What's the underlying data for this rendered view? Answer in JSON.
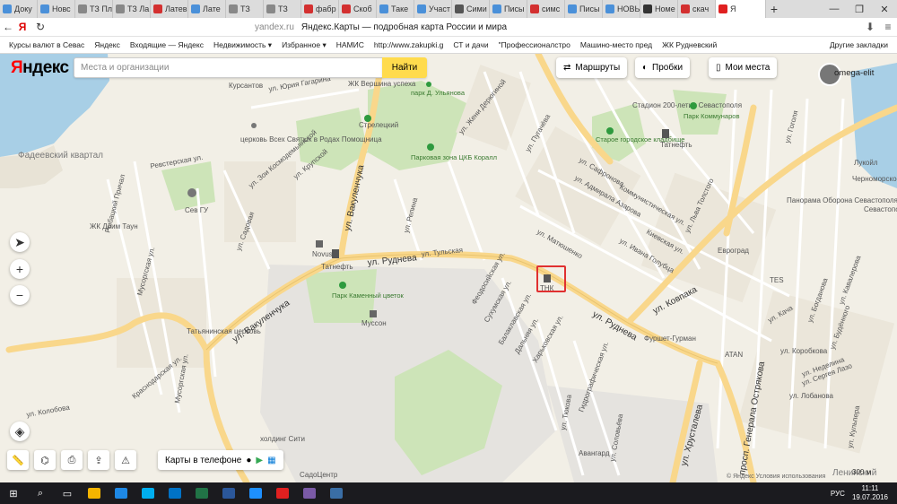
{
  "browser": {
    "tabs": [
      {
        "label": "Доку",
        "color": "#4a90d9"
      },
      {
        "label": "Новс",
        "color": "#4a90d9"
      },
      {
        "label": "ТЗ Пл",
        "color": "#888888"
      },
      {
        "label": "ТЗ Ла",
        "color": "#888888"
      },
      {
        "label": "Латев",
        "color": "#d33030"
      },
      {
        "label": "Лате",
        "color": "#4a90d9"
      },
      {
        "label": "ТЗ",
        "color": "#888888"
      },
      {
        "label": "ТЗ",
        "color": "#888888"
      },
      {
        "label": "фабр",
        "color": "#d33030"
      },
      {
        "label": "Скоб",
        "color": "#d33030"
      },
      {
        "label": "Таке",
        "color": "#4a90d9"
      },
      {
        "label": "Участ",
        "color": "#4a90d9"
      },
      {
        "label": "Сими",
        "color": "#555555"
      },
      {
        "label": "Писы",
        "color": "#4a90d9"
      },
      {
        "label": "симс",
        "color": "#d33030"
      },
      {
        "label": "Писы",
        "color": "#4a90d9"
      },
      {
        "label": "НОВЫ",
        "color": "#4a90d9"
      },
      {
        "label": "Номе",
        "color": "#333333"
      },
      {
        "label": "скач",
        "color": "#d33030"
      },
      {
        "label": "Я",
        "color": "#e02020"
      }
    ],
    "address": {
      "logo_letter": "Я",
      "domain": "yandex.ru",
      "title": "Яндекс.Карты — подробная карта России и мира"
    },
    "bookmarks": [
      "Курсы валют в Севас",
      "Яндекс",
      "Входящие — Яндекс",
      "Недвижимость ▾",
      "Избранное ▾",
      "НАМИС",
      "http://www.zakupki.g",
      "СТ и дачи",
      "\"Профессионалстро",
      "Машино-место пред",
      "ЖК Рудневский"
    ],
    "bookmarks_other": "Другие закладки"
  },
  "map_ui": {
    "logo_ya": "Я",
    "logo_rest": "ндекс",
    "search_placeholder": "Места и организации",
    "search_button": "Найти",
    "routes_button": "Маршруты",
    "traffic_button": "Пробки",
    "my_places_button": "Мои места",
    "username": "omega-elit",
    "phone_label": "Карты в телефоне",
    "scale_label": "300 м",
    "copyright": "© Яндекс Условия использования"
  },
  "map_labels": {
    "districts": [
      "Фадеевский квартал",
      "Ленинский"
    ],
    "roads": [
      "ул. Руднева",
      "ул. Вакуленчука",
      "ул. Ковпака",
      "ул. Руднева",
      "ул. Хрусталева",
      "просп. Генерала Острякова",
      "ул. Вакуленчука"
    ],
    "streets": [
      "ул. Гагарина",
      "ул. Юрия Гагарина",
      "ул. Зои Космодемьянской",
      "ул. Крупской",
      "ул. Глухова",
      "ул. Садовая",
      "ул. Тульская",
      "ул. Репина",
      "ул. Жени Дерюгиной",
      "ул. Пугачёва",
      "ул. Матюшенко",
      "Киевская ул.",
      "ул. Льва Толстого",
      "ул. Гоголя",
      "ул. Адмирала Азарова",
      "Коммунистическая ул.",
      "ул. Сафронова",
      "ул. Ивана Голубца",
      "Рыбацкий Причал",
      "Ревстерская ул.",
      "Мусоргская ул.",
      "Кожанова ул.",
      "ул. Колобова",
      "Краснодарская ул.",
      "Гидрографическая ул.",
      "ул. Тюкова",
      "ул. Соловьёва",
      "ул. Гидрографическая",
      "Харьковская ул.",
      "Дальняя ул.",
      "Балаклавская ул.",
      "Сухумская ул.",
      "Феодосийская ул.",
      "ул. Лобанова",
      "ул. Коробкова",
      "ул. Кульпера",
      "ул. Богданова",
      "ул. Будённого",
      "ул. Кукловского",
      "ул. Кача",
      "ул. Частника",
      "ул. Неделина",
      "ул. Сергея Лазо",
      "ул. Кавалерова"
    ],
    "pois": [
      "Стрелецкий",
      "церковь Всех Святых в Родах Помощница",
      "Сев ГУ",
      "Татнефть",
      "Novus",
      "Муссон",
      "Парк Каменный цветок",
      "Парковая зона ЦКБ Коралл",
      "парк Д. Ульянова",
      "ЖК Вершина успеха",
      "Стадион 200-летия Севастополя",
      "Парк Коммунаров",
      "Старое городское кладбище",
      "ТНК",
      "Евроград",
      "Фуршет-Гурман",
      "ATAN",
      "TES",
      "Татнефть",
      "Панорама Оборона Севастополя",
      "Севастопольская",
      "Авангард",
      "холдинг Сити",
      "СадоЦентр",
      "ЖК Дрим Таун",
      "Татьянинская церковь",
      "Лукойл",
      "Черноморское",
      "Адмиралтейский",
      "Курсантов",
      "Мебель",
      "Свет",
      "Рыбацкая ул."
    ]
  },
  "taskbar": {
    "time": "11:11",
    "date": "19.07.2016",
    "lang": "РУС",
    "apps": [
      {
        "color": "#f4b400"
      },
      {
        "color": "#1e88e5"
      },
      {
        "color": "#00aff0"
      },
      {
        "color": "#0072c6"
      },
      {
        "color": "#217346"
      },
      {
        "color": "#2b579a"
      },
      {
        "color": "#1e90ff"
      },
      {
        "color": "#e02020"
      },
      {
        "color": "#7a5aa6"
      },
      {
        "color": "#3a6ea5"
      }
    ]
  },
  "colors": {
    "map_bg": "#f2efe6",
    "park": "#cde4b8",
    "water": "#a8cfe6",
    "main_road": "#f9d78b",
    "search_button": "#ffdb4d",
    "tnk_box": "#e03030"
  }
}
